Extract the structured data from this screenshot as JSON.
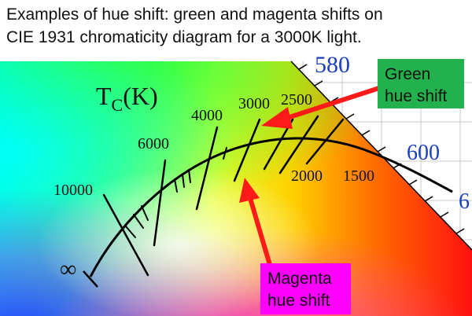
{
  "title": {
    "line1": "Examples of hue shift: green and magenta shifts on",
    "line2": "CIE 1931 chromaticity diagram for a 3000K light."
  },
  "diagram": {
    "tc_label_main": "T",
    "tc_label_sub": "C",
    "tc_label_unit": "(K)",
    "cct_labels": [
      "10000",
      "6000",
      "4000",
      "3000",
      "2500",
      "2000",
      "1500"
    ],
    "infinity_label": "∞",
    "wavelength_labels": [
      "580",
      "600",
      "6"
    ],
    "green_label_line1": "Green",
    "green_label_line2": "hue shift",
    "magenta_label_line1": "Magenta",
    "magenta_label_line2": "hue shift",
    "colors": {
      "green_box": "#22b14c",
      "magenta_box": "#ff00ff",
      "arrow": "#ff1a1a",
      "wavelength_text": "#1a3fbf",
      "grid": "#c8c8c8"
    }
  }
}
